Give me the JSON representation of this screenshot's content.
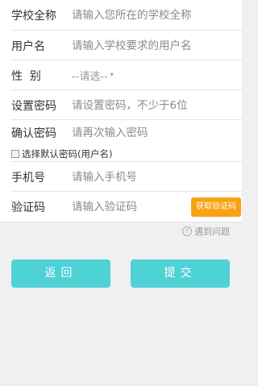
{
  "form": {
    "school": {
      "label": "学校全称",
      "placeholder": "请输入您所在的学校全称"
    },
    "username": {
      "label": "用户名",
      "placeholder": "请输入学校要求的用户名"
    },
    "gender": {
      "label": "性  别",
      "value": "--请选--"
    },
    "password": {
      "label": "设置密码",
      "placeholder": "请设置密码，不少于6位"
    },
    "confirm": {
      "label": "确认密码",
      "placeholder": "请再次输入密码"
    },
    "default_pwd": {
      "label": "选择默认密码(用户名)",
      "checked": false
    },
    "phone": {
      "label": "手机号",
      "placeholder": "请输入手机号"
    },
    "code": {
      "label": "验证码",
      "placeholder": "请输入验证码",
      "button": "获取验证码"
    }
  },
  "help": {
    "icon": "question-circle-icon",
    "text": "遇到问题"
  },
  "actions": {
    "back": "返回",
    "submit": "提交"
  },
  "colors": {
    "accent": "#4fd2d6",
    "code_button": "#f7a313",
    "background": "#f0f0f2"
  }
}
